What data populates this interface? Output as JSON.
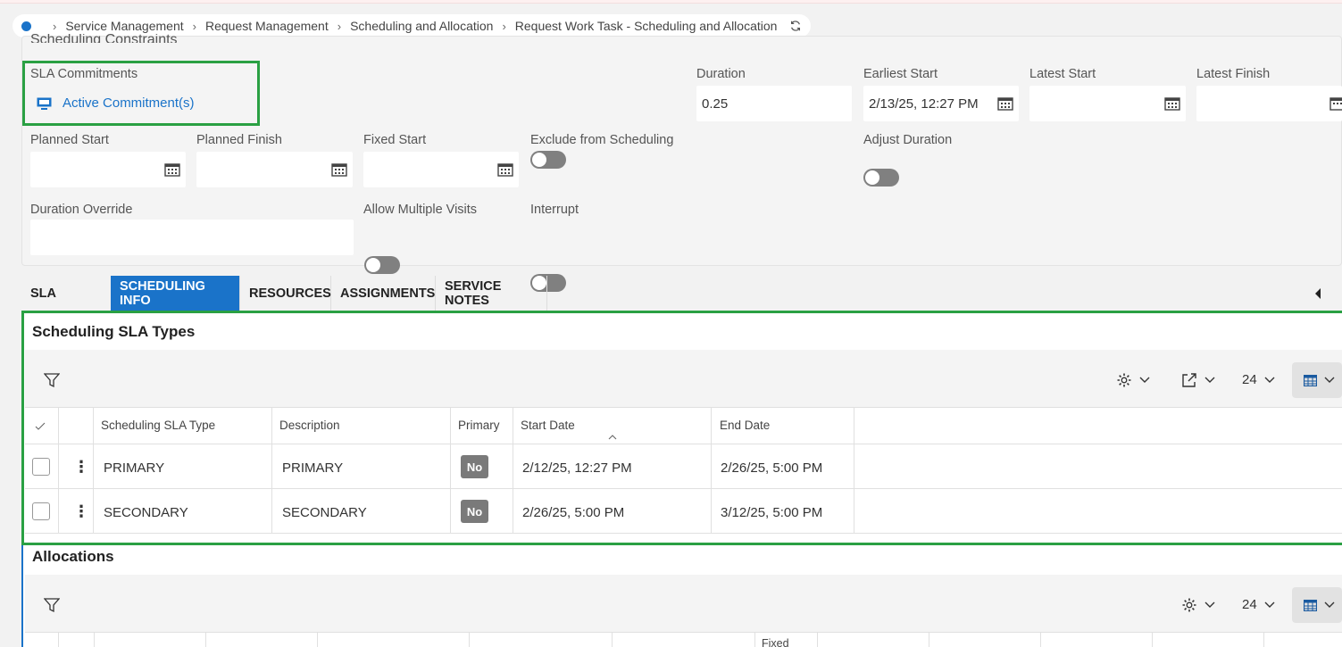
{
  "breadcrumb": {
    "items": [
      "Service Management",
      "Request Management",
      "Scheduling and Allocation",
      "Request Work Task - Scheduling and Allocation"
    ]
  },
  "section": {
    "title": "Scheduling Constraints"
  },
  "form": {
    "sla_commitments_label": "SLA Commitments",
    "active_commitments_link": "Active Commitment(s)",
    "duration_label": "Duration",
    "duration_value": "0.25",
    "earliest_start_label": "Earliest Start",
    "earliest_start_value": "2/13/25, 12:27 PM",
    "latest_start_label": "Latest Start",
    "latest_finish_label": "Latest Finish",
    "planned_start_label": "Planned Start",
    "planned_finish_label": "Planned Finish",
    "fixed_start_label": "Fixed Start",
    "exclude_label": "Exclude from Scheduling",
    "adjust_duration_label": "Adjust Duration",
    "duration_override_label": "Duration Override",
    "allow_multiple_label": "Allow Multiple Visits",
    "interrupt_label": "Interrupt"
  },
  "tabs": [
    "SLA",
    "SCHEDULING INFO",
    "RESOURCES",
    "ASSIGNMENTS",
    "SERVICE NOTES"
  ],
  "sla_types": {
    "title": "Scheduling SLA Types",
    "page_size": "24",
    "columns": [
      "Scheduling SLA Type",
      "Description",
      "Primary",
      "Start Date",
      "End Date"
    ],
    "rows": [
      {
        "type": "PRIMARY",
        "description": "PRIMARY",
        "primary": "No",
        "start": "2/12/25, 12:27 PM",
        "end": "2/26/25, 5:00 PM"
      },
      {
        "type": "SECONDARY",
        "description": "SECONDARY",
        "primary": "No",
        "start": "2/26/25, 5:00 PM",
        "end": "3/12/25, 5:00 PM"
      }
    ]
  },
  "allocations": {
    "title": "Allocations",
    "page_size": "24",
    "partial_header": "Fixed"
  },
  "colors": {
    "accent": "#1a73c9",
    "highlight": "#2aa043",
    "toggle_off": "#808080"
  }
}
